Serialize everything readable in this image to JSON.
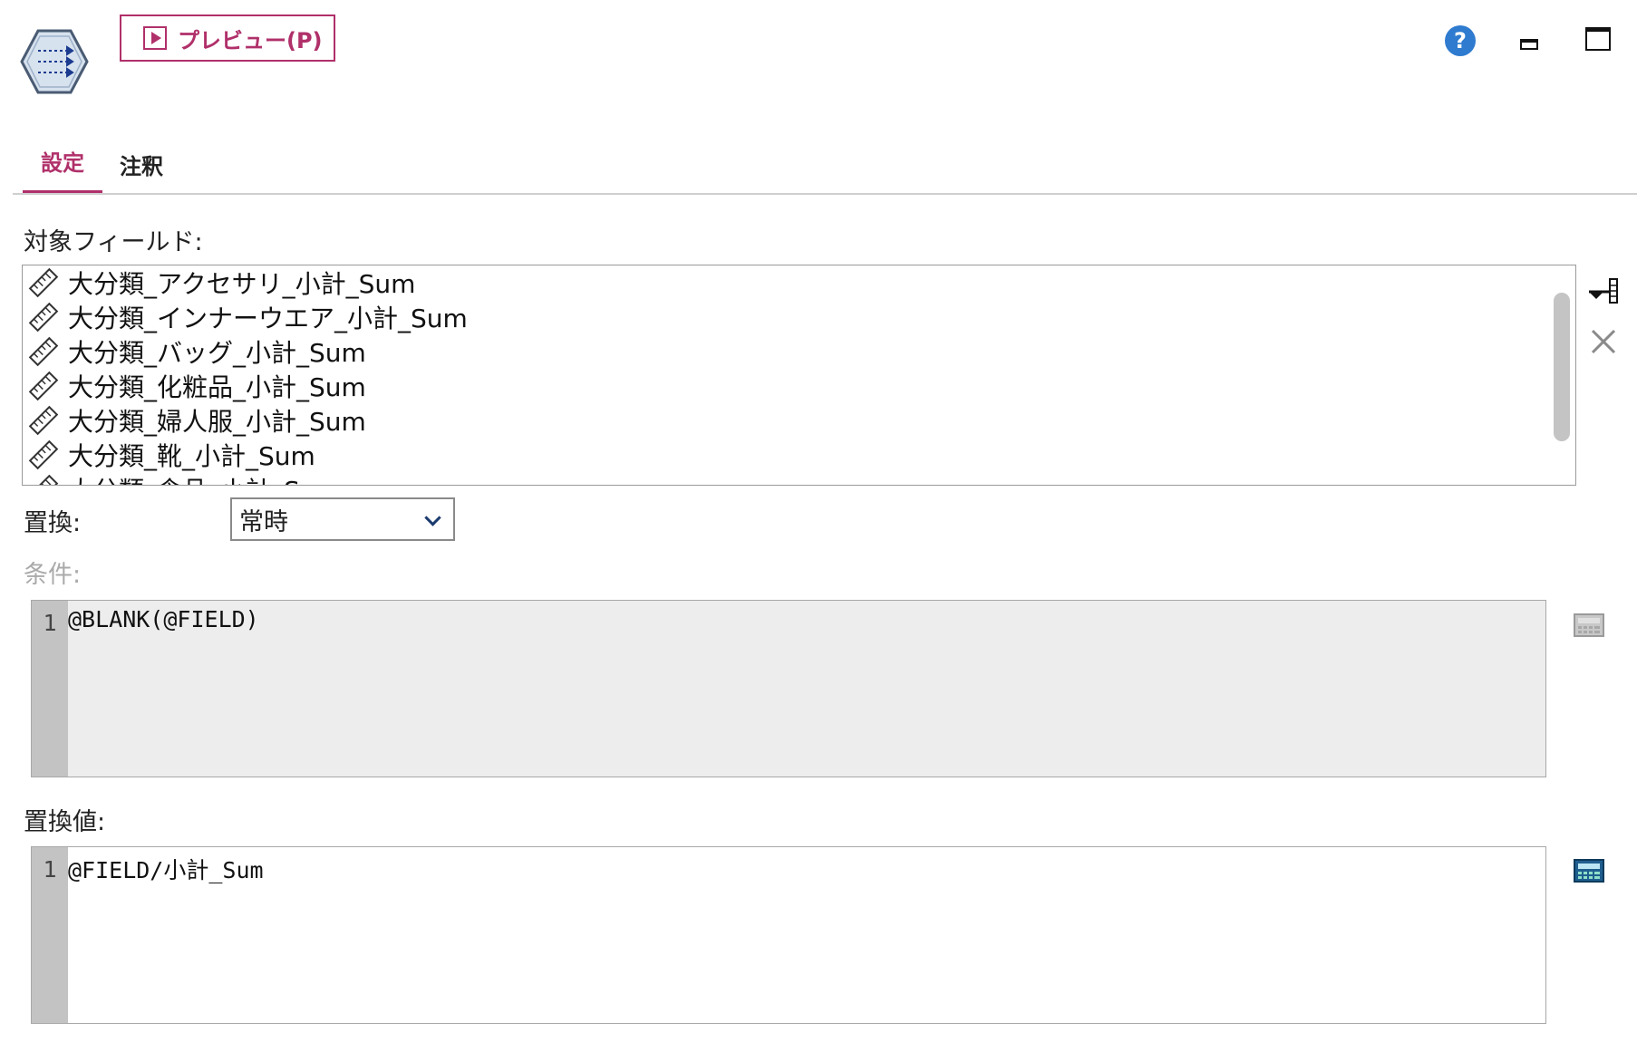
{
  "header": {
    "node_icon": "filler-node-icon",
    "preview_label": "プレビュー(P)",
    "help_icon": "help-icon",
    "help_glyph": "?"
  },
  "tabs": [
    {
      "label": "設定",
      "active": true
    },
    {
      "label": "注釈",
      "active": false
    }
  ],
  "fields_section": {
    "label": "対象フィールド:",
    "items": [
      "大分類_アクセサリ_小計_Sum",
      "大分類_インナーウエア_小計_Sum",
      "大分類_バッグ_小計_Sum",
      "大分類_化粧品_小計_Sum",
      "大分類_婦人服_小計_Sum",
      "大分類_靴_小計_Sum",
      "大分類_食品_小計_Sum"
    ],
    "item_icon": "ruler-icon"
  },
  "replace": {
    "label": "置換:",
    "selected": "常時"
  },
  "condition": {
    "label": "条件:",
    "line_number": "1",
    "code": "@BLANK(@FIELD)"
  },
  "replace_value": {
    "label": "置換値:",
    "line_number": "1",
    "code": "@FIELD/小計_Sum"
  },
  "colors": {
    "accent": "#b0306a",
    "help": "#2e7bcf",
    "gutter": "#c3c3c3",
    "disabled_editor": "#ededed"
  }
}
